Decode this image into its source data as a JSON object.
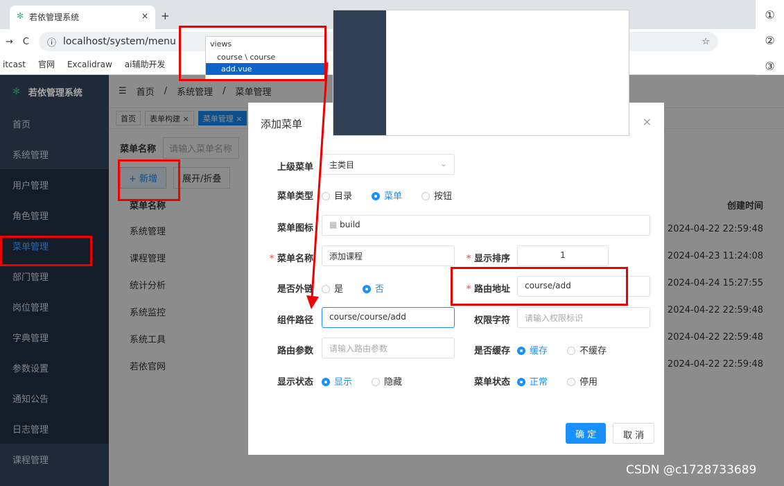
{
  "browser": {
    "tab": "若依管理系统",
    "url": "localhost/system/menu",
    "bookmarks": [
      "itcast",
      "官网",
      "Excalidraw",
      "ai辅助开发"
    ],
    "side_numbers": [
      "①",
      "②",
      "③"
    ]
  },
  "app": {
    "logo": "若依管理系统",
    "breadcrumb": [
      "首页",
      "系统管理",
      "菜单管理"
    ],
    "tags": [
      "首页",
      "表单构建 ×",
      "菜单管理 ×"
    ],
    "sidebar": [
      "首页",
      "系统管理",
      "用户管理",
      "角色管理",
      "菜单管理",
      "部门管理",
      "岗位管理",
      "字典管理",
      "参数设置",
      "通知公告",
      "日志管理",
      "课程管理"
    ],
    "search_label": "菜单名称",
    "search_placeholder": "请输入菜单名称",
    "add": "+ 新增",
    "expand": "展开/折叠",
    "col_name": "菜单名称",
    "col_time": "创建时间",
    "rows": [
      {
        "n": "系统管理",
        "t": "2024-04-22 22:59:48"
      },
      {
        "n": "课程管理",
        "t": "2024-04-23 11:24:08"
      },
      {
        "n": "统计分析",
        "t": "2024-04-24 15:27:55"
      },
      {
        "n": "系统监控",
        "t": "2024-04-22 22:59:48"
      },
      {
        "n": "系统工具",
        "t": "2024-04-22 22:59:48"
      },
      {
        "n": "若依官网",
        "t": "2024-04-22 22:59:48"
      }
    ]
  },
  "dialog": {
    "title": "添加菜单",
    "parent_label": "上级菜单",
    "parent": "主类目",
    "type_label": "菜单类型",
    "types": [
      "目录",
      "菜单",
      "按钮"
    ],
    "icon_label": "菜单图标",
    "icon": "build",
    "name_label": "菜单名称",
    "name": "添加课程",
    "order_label": "显示排序",
    "order": "1",
    "ext_label": "是否外链",
    "yes": "是",
    "no": "否",
    "route_label": "路由地址",
    "route": "course/add",
    "comp_label": "组件路径",
    "comp": "course/course/add",
    "perm_label": "权限字符",
    "perm_ph": "请输入权限标识",
    "param_label": "路由参数",
    "param_ph": "请输入路由参数",
    "cache_label": "是否缓存",
    "cache": "缓存",
    "nocache": "不缓存",
    "show_label": "显示状态",
    "show": "显示",
    "hide": "隐藏",
    "status_label": "菜单状态",
    "normal": "正常",
    "stop": "停用",
    "ok": "确 定",
    "cancel": "取 消"
  },
  "code": {
    "l1": "views",
    "l2": "course \\ course",
    "l3": "add.vue"
  },
  "watermark": "CSDN @c1728733689"
}
